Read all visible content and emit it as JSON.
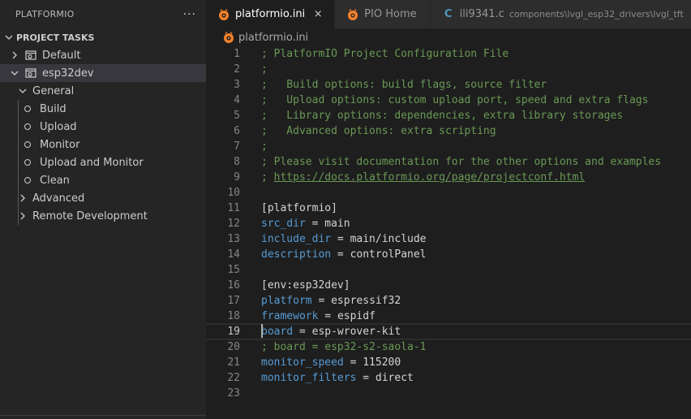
{
  "sidebar": {
    "title": "PLATFORMIO",
    "more": "···",
    "section": "PROJECT TASKS",
    "items": [
      {
        "label": "Default"
      },
      {
        "label": "esp32dev"
      },
      {
        "label": "General"
      },
      {
        "label": "Build"
      },
      {
        "label": "Upload"
      },
      {
        "label": "Monitor"
      },
      {
        "label": "Upload and Monitor"
      },
      {
        "label": "Clean"
      },
      {
        "label": "Advanced"
      },
      {
        "label": "Remote Development"
      }
    ]
  },
  "tabs": [
    {
      "label": "platformio.ini",
      "close": "×"
    },
    {
      "label": "PIO Home"
    },
    {
      "label": "ili9341.c",
      "icon_letter": "C",
      "path": "components\\lvgl_esp32_drivers\\lvgl_tft"
    },
    {
      "icon_letter": "C"
    }
  ],
  "breadcrumb": {
    "file": "platformio.ini"
  },
  "code": [
    {
      "n": "1",
      "t": "; PlatformIO Project Configuration File"
    },
    {
      "n": "2",
      "t": ";"
    },
    {
      "n": "3",
      "t": ";   Build options: build flags, source filter"
    },
    {
      "n": "4",
      "t": ";   Upload options: custom upload port, speed and extra flags"
    },
    {
      "n": "5",
      "t": ";   Library options: dependencies, extra library storages"
    },
    {
      "n": "6",
      "t": ";   Advanced options: extra scripting"
    },
    {
      "n": "7",
      "t": ";"
    },
    {
      "n": "8",
      "t": "; Please visit documentation for the other options and examples"
    },
    {
      "n": "9",
      "t": "; ",
      "link": "https://docs.platformio.org/page/projectconf.html"
    },
    {
      "n": "10"
    },
    {
      "n": "11",
      "t": "[platformio]"
    },
    {
      "n": "12",
      "k": "src_dir",
      "eq": " = ",
      "v": "main"
    },
    {
      "n": "13",
      "k": "include_dir",
      "eq": " = ",
      "v": "main/include"
    },
    {
      "n": "14",
      "k": "description",
      "eq": " = ",
      "v": "controlPanel"
    },
    {
      "n": "15"
    },
    {
      "n": "16",
      "t": "[env:esp32dev]"
    },
    {
      "n": "17",
      "k": "platform",
      "eq": " = ",
      "v": "espressif32"
    },
    {
      "n": "18",
      "k": "framework",
      "eq": " = ",
      "v": "espidf"
    },
    {
      "n": "19",
      "k": "board",
      "eq": " = ",
      "v": "esp-wrover-kit"
    },
    {
      "n": "20",
      "t": "; board = esp32-s2-saola-1"
    },
    {
      "n": "21",
      "k": "monitor_speed",
      "eq": " = ",
      "v": "115200"
    },
    {
      "n": "22",
      "k": "monitor_filters",
      "eq": " = ",
      "v": "direct"
    },
    {
      "n": "23"
    }
  ],
  "colors": {
    "comment": "#6a9955",
    "key": "#569cd6",
    "text": "#d4d4d4",
    "pio_orange": "#f5822a"
  }
}
